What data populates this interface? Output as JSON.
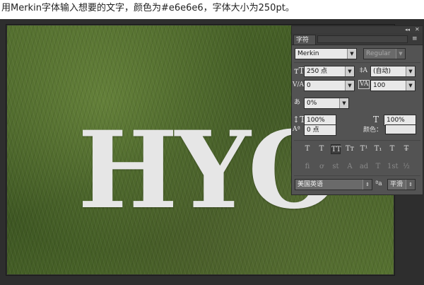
{
  "instruction": "用Merkin字体输入想要的文字，颜色为#e6e6e6，字体大小为250pt。",
  "canvas": {
    "text": "HYO",
    "text_color": "#e6e6e6"
  },
  "panel": {
    "tab_title": "字符",
    "collapse": "◂◂",
    "close": "✕",
    "menu_icon": "≡",
    "font_family": "Merkin",
    "font_style": "Regular",
    "font_size": "250 点",
    "leading": "(自动)",
    "kerning": "0",
    "tracking": "100",
    "vertical_scale": "100%",
    "baseline_shift_pct": "0%",
    "horizontal_scale": "100%",
    "baseline_shift": "0 点",
    "color_label": "颜色：",
    "color_value": "#e6e6e6",
    "language": "美国英语",
    "antialias_label": "ªa",
    "antialias": "平滑",
    "style_buttons": [
      "T",
      "T",
      "TT",
      "Tт",
      "T¹",
      "T₁",
      "T",
      "T̶"
    ],
    "opentype_buttons": [
      "fi",
      "ơ",
      "st",
      "A",
      "ad",
      "T",
      "1st",
      "½"
    ]
  }
}
